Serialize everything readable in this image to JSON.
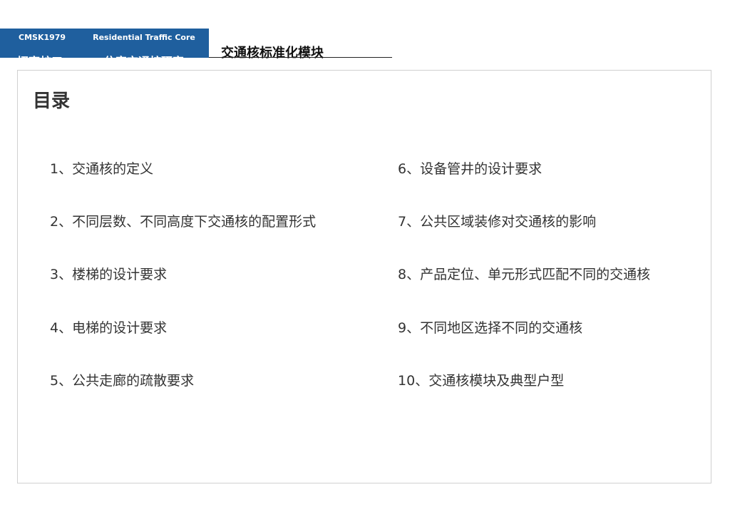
{
  "header": {
    "brand_code": "CMSK1979",
    "brand_cn": "招商蛇口",
    "project_en": "Residential Traffic Core",
    "project_cn": "住宅交通核研究",
    "module_title": "交通核标准化模块"
  },
  "toc": {
    "heading": "目录",
    "items": [
      {
        "num": "1",
        "sep": "、",
        "text": "交通核的定义"
      },
      {
        "num": "2",
        "sep": "、",
        "text": "不同层数、不同高度下交通核的配置形式"
      },
      {
        "num": "3",
        "sep": "、",
        "text": "楼梯的设计要求"
      },
      {
        "num": "4",
        "sep": "、",
        "text": "电梯的设计要求"
      },
      {
        "num": "5",
        "sep": "、",
        "text": "公共走廊的疏散要求"
      },
      {
        "num": "6",
        "sep": "、",
        "text": "设备管井的设计要求"
      },
      {
        "num": "7",
        "sep": "、",
        "text": "公共区域装修对交通核的影响"
      },
      {
        "num": "8",
        "sep": "、",
        "text": "产品定位、单元形式匹配不同的交通核"
      },
      {
        "num": "9",
        "sep": "、",
        "text": "不同地区选择不同的交通核"
      },
      {
        "num": "10",
        "sep": "、",
        "text": "交通核模块及典型户型"
      }
    ]
  }
}
